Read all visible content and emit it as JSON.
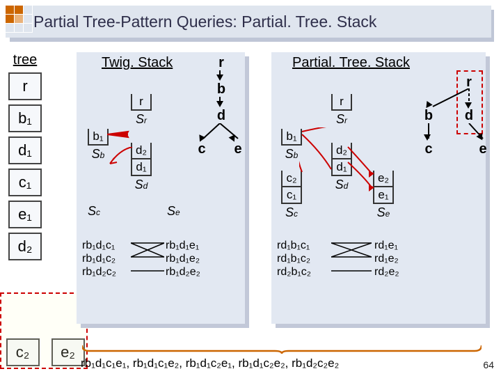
{
  "title": "Partial Tree-Pattern Queries: Partial. Tree. Stack",
  "page_number": "64",
  "tree": {
    "label": "tree",
    "nodes": [
      "r",
      "b₁",
      "d₁",
      "c₁",
      "e₁",
      "d₂"
    ],
    "bottom": [
      "c₂",
      "e₂"
    ]
  },
  "panels": {
    "left": {
      "title": "Twig. Stack"
    },
    "right": {
      "title": "Partial. Tree. Stack"
    }
  },
  "stacks_left": {
    "Sr": {
      "label": "Sᵣ",
      "cells": [
        "r"
      ]
    },
    "Sb": {
      "label": "S_b",
      "cells": [
        "b₁"
      ]
    },
    "Sd": {
      "label": "S_d",
      "cells": [
        "d₁",
        "d₂"
      ]
    },
    "Sc": {
      "label": "S_c",
      "cells": []
    },
    "Se": {
      "label": "S_e",
      "cells": []
    }
  },
  "stacks_right": {
    "Sr": {
      "label": "Sᵣ",
      "cells": [
        "r"
      ]
    },
    "Sb": {
      "label": "S_b",
      "cells": [
        "b₁"
      ]
    },
    "Sd": {
      "label": "S_d",
      "cells": [
        "d₁",
        "d₂"
      ]
    },
    "Sc": {
      "label": "S_c",
      "cells": [
        "c₁",
        "c₂"
      ]
    },
    "Se": {
      "label": "S_e",
      "cells": [
        "e₁",
        "e₂"
      ]
    }
  },
  "query_tree_left": {
    "nodes": {
      "r": "r",
      "b": "b",
      "d": "d",
      "c": "c",
      "e": "e"
    }
  },
  "query_tree_right": {
    "nodes": {
      "r": "r",
      "b": "b",
      "d": "d",
      "c": "c",
      "e": "e"
    }
  },
  "merge_left": {
    "col1": [
      "rb₁d₁c₁",
      "rb₁d₁c₂",
      "rb₁d₂c₂"
    ],
    "col2": [
      "rb₁d₁e₁",
      "rb₁d₁e₂",
      "rb₁d₂e₂"
    ]
  },
  "merge_right": {
    "col1": [
      "rd₁b₁c₁",
      "rd₁b₁c₂",
      "rd₂b₁c₂"
    ],
    "col2": [
      "rd₁e₁",
      "rd₁e₂",
      "rd₂e₂"
    ]
  },
  "bottom_result": "rb₁d₁c₁e₁, rb₁d₁c₁e₂, rb₁d₁c₂e₁, rb₁d₁c₂e₂, rb₁d₂c₂e₂"
}
